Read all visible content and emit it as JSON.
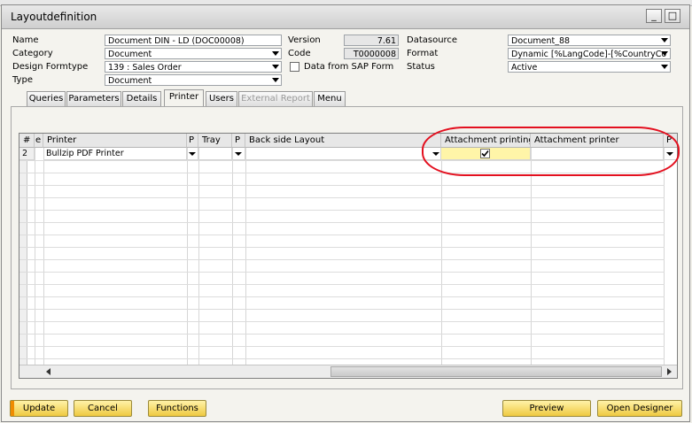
{
  "window": {
    "title": "Layoutdefinition",
    "minimize": "_",
    "maximize": "□"
  },
  "header": {
    "name_label": "Name",
    "name_value": "Document DIN - LD (DOC00008)",
    "category_label": "Category",
    "category_value": "Document",
    "design_formtype_label": "Design Formtype",
    "design_formtype_value": "139 : Sales Order",
    "type_label": "Type",
    "type_value": "Document",
    "version_label": "Version",
    "version_value": "7.61",
    "code_label": "Code",
    "code_value": "T0000008",
    "data_from_sap_form_label": "Data from SAP Form",
    "data_from_sap_form_checked": false,
    "datasource_label": "Datasource",
    "datasource_value": "Document_88",
    "format_label": "Format",
    "format_value": "Dynamic [%LangCode]-[%CountryCo",
    "status_label": "Status",
    "status_value": "Active"
  },
  "tabs": [
    {
      "label": "Queries",
      "state": "normal"
    },
    {
      "label": "Parameters",
      "state": "normal"
    },
    {
      "label": "Details",
      "state": "normal"
    },
    {
      "label": "Printer",
      "state": "active"
    },
    {
      "label": "Users",
      "state": "normal"
    },
    {
      "label": "External Report",
      "state": "disabled"
    },
    {
      "label": "Menu",
      "state": "normal"
    }
  ],
  "grid": {
    "columns": [
      "#",
      "e",
      "Printer",
      "P",
      "Tray",
      "P",
      "Back side Layout",
      "Attachment printing",
      "Attachment printer",
      "P"
    ],
    "rows": [
      {
        "num": "2",
        "printer": "Bullzip PDF Printer",
        "tray": "",
        "back_side_layout": "",
        "attachment_printing": true,
        "attachment_printer": ""
      }
    ]
  },
  "buttons": {
    "update": "Update",
    "cancel": "Cancel",
    "functions": "Functions",
    "preview": "Preview",
    "open_designer": "Open Designer"
  },
  "colors": {
    "highlight": "#e3101f",
    "button_fill": "#efc940",
    "selected_cell": "#fff5a8"
  }
}
